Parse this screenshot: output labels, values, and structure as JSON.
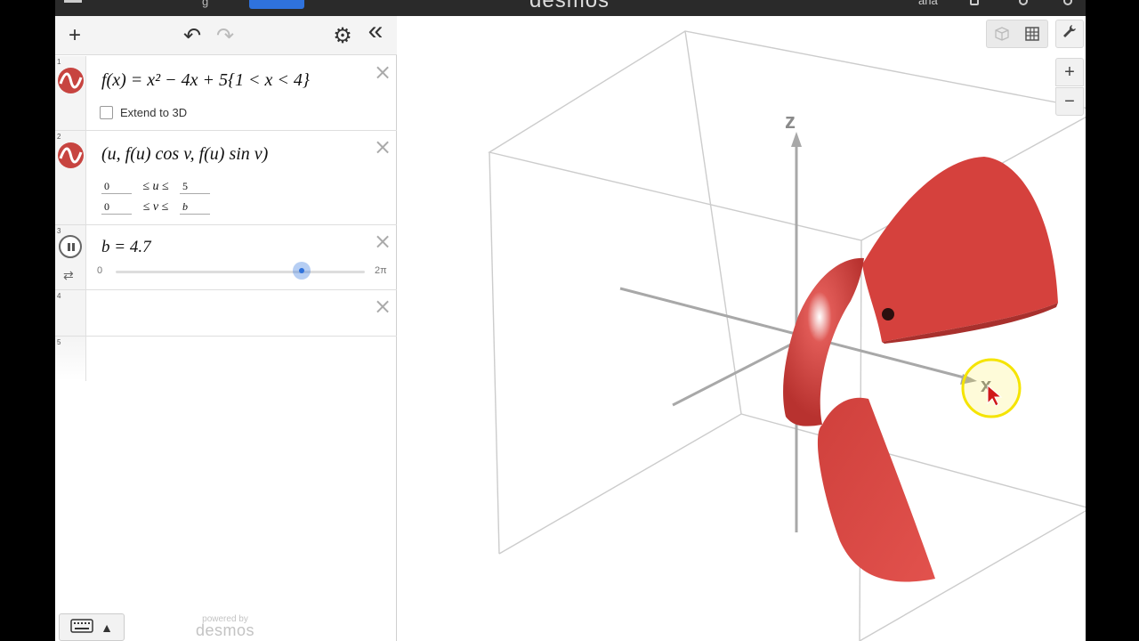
{
  "header": {
    "brand": "desmos",
    "tab_partial": "g",
    "user_partial": "ana"
  },
  "toolbar": {
    "add_label": "+",
    "undo_label": "↶",
    "redo_label": "↷",
    "settings_label": "⚙",
    "collapse_label": "«"
  },
  "expressions": [
    {
      "number": "1",
      "lhs": "f(x) = ",
      "formula_text": "f(x) = x² − 4x + 5{1 < x < 4}",
      "checkbox_label": "Extend to 3D",
      "checked": false,
      "color": "#c74440"
    },
    {
      "number": "2",
      "formula_text": "(u, f(u) cos v, f(u) sin v)",
      "domain": [
        {
          "min": "0",
          "var": "≤ u ≤",
          "max": "5"
        },
        {
          "min": "0",
          "var": "≤ v ≤",
          "max": "b"
        }
      ],
      "color": "#c74440"
    },
    {
      "number": "3",
      "formula_text": "b = 4.7",
      "slider": {
        "min": "0",
        "max": "2π",
        "value": 4.7,
        "range_max": 6.2832
      }
    },
    {
      "number": "4"
    },
    {
      "number": "5"
    }
  ],
  "footer": {
    "keyboard_arrow": "▲",
    "powered_small": "powered by",
    "powered_big": "desmos"
  },
  "graph_controls": {
    "zoom_in": "+",
    "zoom_out": "−",
    "wrench": "🔧"
  },
  "axes": {
    "z_label": "z",
    "x_label": "x"
  },
  "colors": {
    "surface": "#c74440",
    "slider_accent": "#2f72dc",
    "cursor_highlight": "#f5e400"
  }
}
